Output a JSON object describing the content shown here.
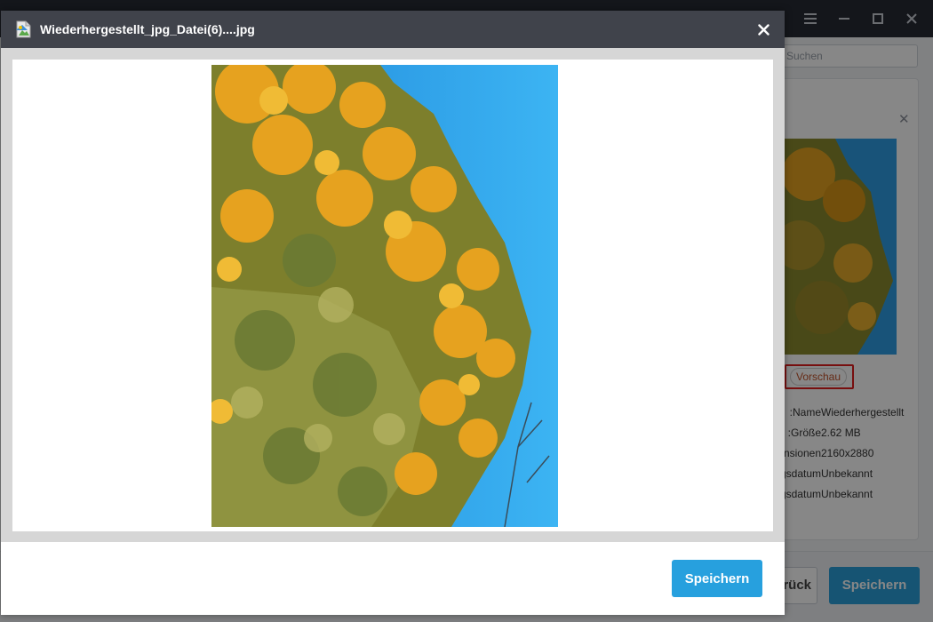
{
  "background_app": {
    "search_placeholder": "Suchen",
    "preview_button_label": "Vorschau",
    "info": [
      {
        "key": "Name:",
        "value": "Wiederhergestellt"
      },
      {
        "key": "Größe:",
        "value": "2.62 MB"
      },
      {
        "key": "Dimensionen:",
        "value": "2160x2880"
      },
      {
        "key": "Erstellungsdatum:",
        "value": "Unbekannt"
      },
      {
        "key": "Änderungsdatum:",
        "value": "Unbekannt"
      }
    ],
    "back_button_label": "Zurück zur Liste",
    "save_button_label": "Speichern",
    "window_icons": [
      "headset-icon",
      "menu-icon",
      "minimize-icon",
      "maximize-icon",
      "close-icon"
    ]
  },
  "preview_dialog": {
    "title": "Wiederhergestellt_jpg_Datei(6)....jpg",
    "file_icon": "image-file-icon",
    "close_icon": "close-icon",
    "image_subject": "yellow-flowering tree against blue sky",
    "save_button_label": "Speichern"
  },
  "colors": {
    "header_bg": "#40434b",
    "accent_blue": "#27a0de",
    "highlight_red": "#e01e1e",
    "sky_blue": "#2f9fe6",
    "blossom_yellow": "#e7a423"
  }
}
